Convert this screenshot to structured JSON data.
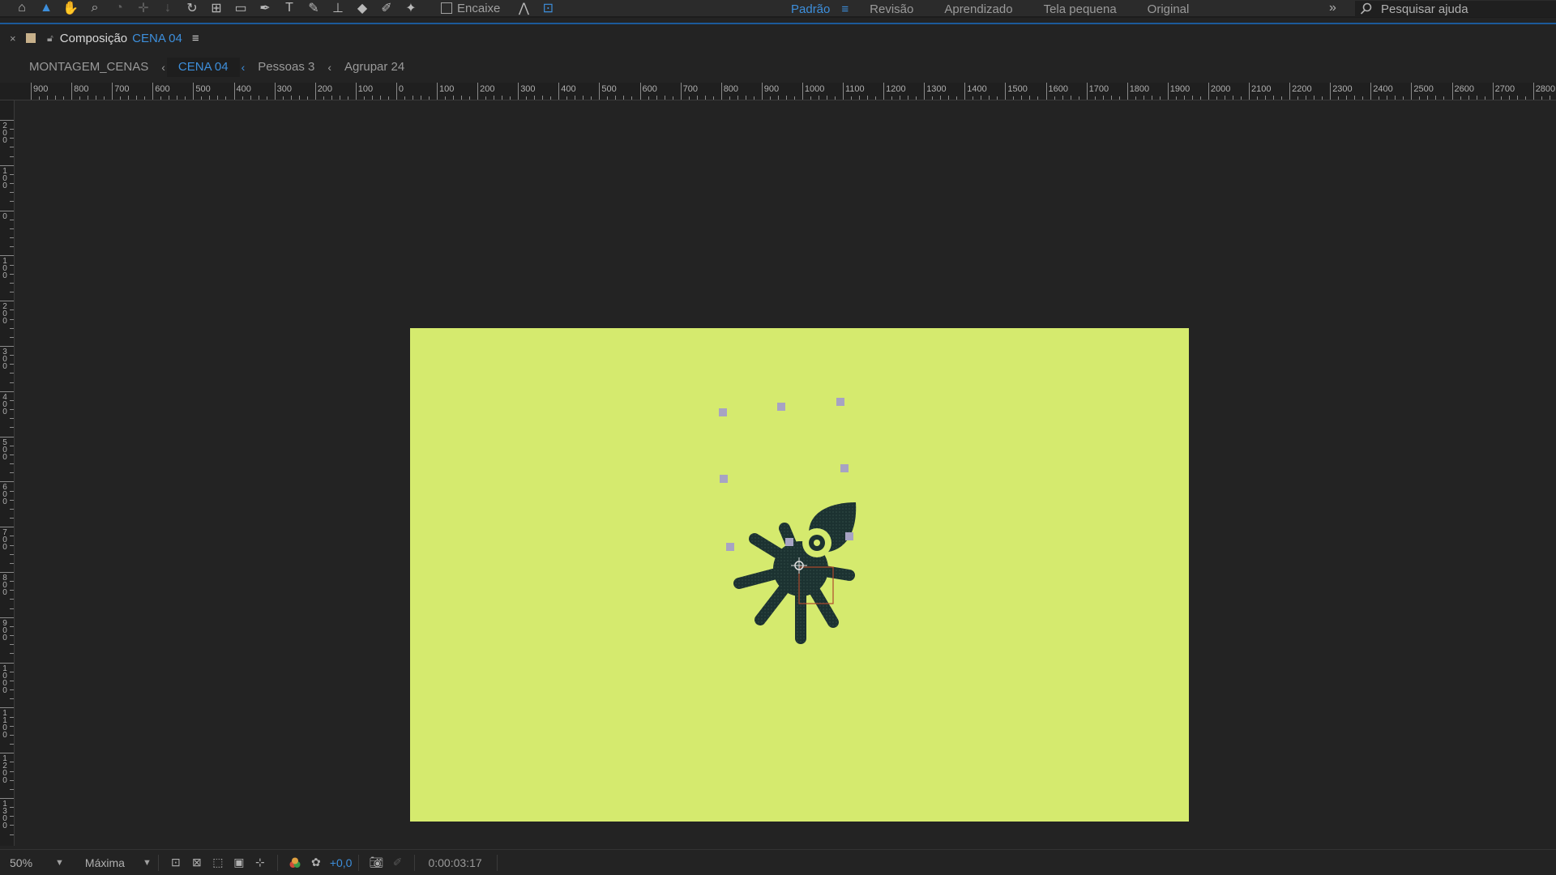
{
  "toolbar": {
    "tools": [
      {
        "name": "home-icon",
        "glyph": "⌂"
      },
      {
        "name": "selection-tool-icon",
        "glyph": "▲"
      },
      {
        "name": "hand-tool-icon",
        "glyph": "✋"
      },
      {
        "name": "zoom-tool-icon",
        "glyph": "⌕"
      },
      {
        "name": "orbit-camera-icon",
        "glyph": "◔"
      },
      {
        "name": "pan-camera-icon",
        "glyph": "✛"
      },
      {
        "name": "dolly-camera-icon",
        "glyph": "↓"
      },
      {
        "name": "rotate-tool-icon",
        "glyph": "↻"
      },
      {
        "name": "pan-behind-icon",
        "glyph": "⊞"
      },
      {
        "name": "rectangle-tool-icon",
        "glyph": "▭"
      },
      {
        "name": "pen-tool-icon",
        "glyph": "✒"
      },
      {
        "name": "text-tool-icon",
        "glyph": "T"
      },
      {
        "name": "brush-tool-icon",
        "glyph": "✎"
      },
      {
        "name": "clone-stamp-icon",
        "glyph": "⊥"
      },
      {
        "name": "eraser-tool-icon",
        "glyph": "◆"
      },
      {
        "name": "roto-brush-icon",
        "glyph": "✐"
      },
      {
        "name": "puppet-tool-icon",
        "glyph": "✦"
      }
    ],
    "snap_label": "Encaixe"
  },
  "workspaces": {
    "items": [
      "Padrão",
      "Revisão",
      "Aprendizado",
      "Tela pequena",
      "Original"
    ],
    "active": "Padrão"
  },
  "help": {
    "placeholder": "Pesquisar ajuda"
  },
  "panel": {
    "label": "Composição",
    "comp_name": "CENA 04"
  },
  "breadcrumbs": {
    "items": [
      "MONTAGEM_CENAS",
      "CENA 04",
      "Pessoas 3",
      "Agrupar 24"
    ]
  },
  "ruler": {
    "h_labels": [
      "900",
      "800",
      "700",
      "600",
      "500",
      "400",
      "300",
      "200",
      "100",
      "0",
      "100",
      "200",
      "300",
      "400",
      "500",
      "600",
      "700",
      "800",
      "900",
      "1000",
      "1100",
      "1200",
      "1300",
      "1400",
      "1500",
      "1600",
      "1700",
      "1800",
      "1900",
      "2000",
      "2100",
      "2200",
      "2300",
      "2400",
      "2500",
      "2600",
      "2700",
      "2800"
    ],
    "v_labels": [
      "200",
      "100",
      "0",
      "100",
      "200",
      "300",
      "400",
      "500",
      "600",
      "700",
      "800",
      "900",
      "1000",
      "1100",
      "1200",
      "1300"
    ]
  },
  "viewer": {
    "background_color": "#d5ea6e",
    "character_color": "#1c3231"
  },
  "status": {
    "zoom": "50%",
    "resolution": "Máxima",
    "exposure": "+0,0",
    "timecode": "0:00:03:17"
  },
  "colors": {
    "accent": "#3d8fdc",
    "panel_bg": "#232323"
  }
}
